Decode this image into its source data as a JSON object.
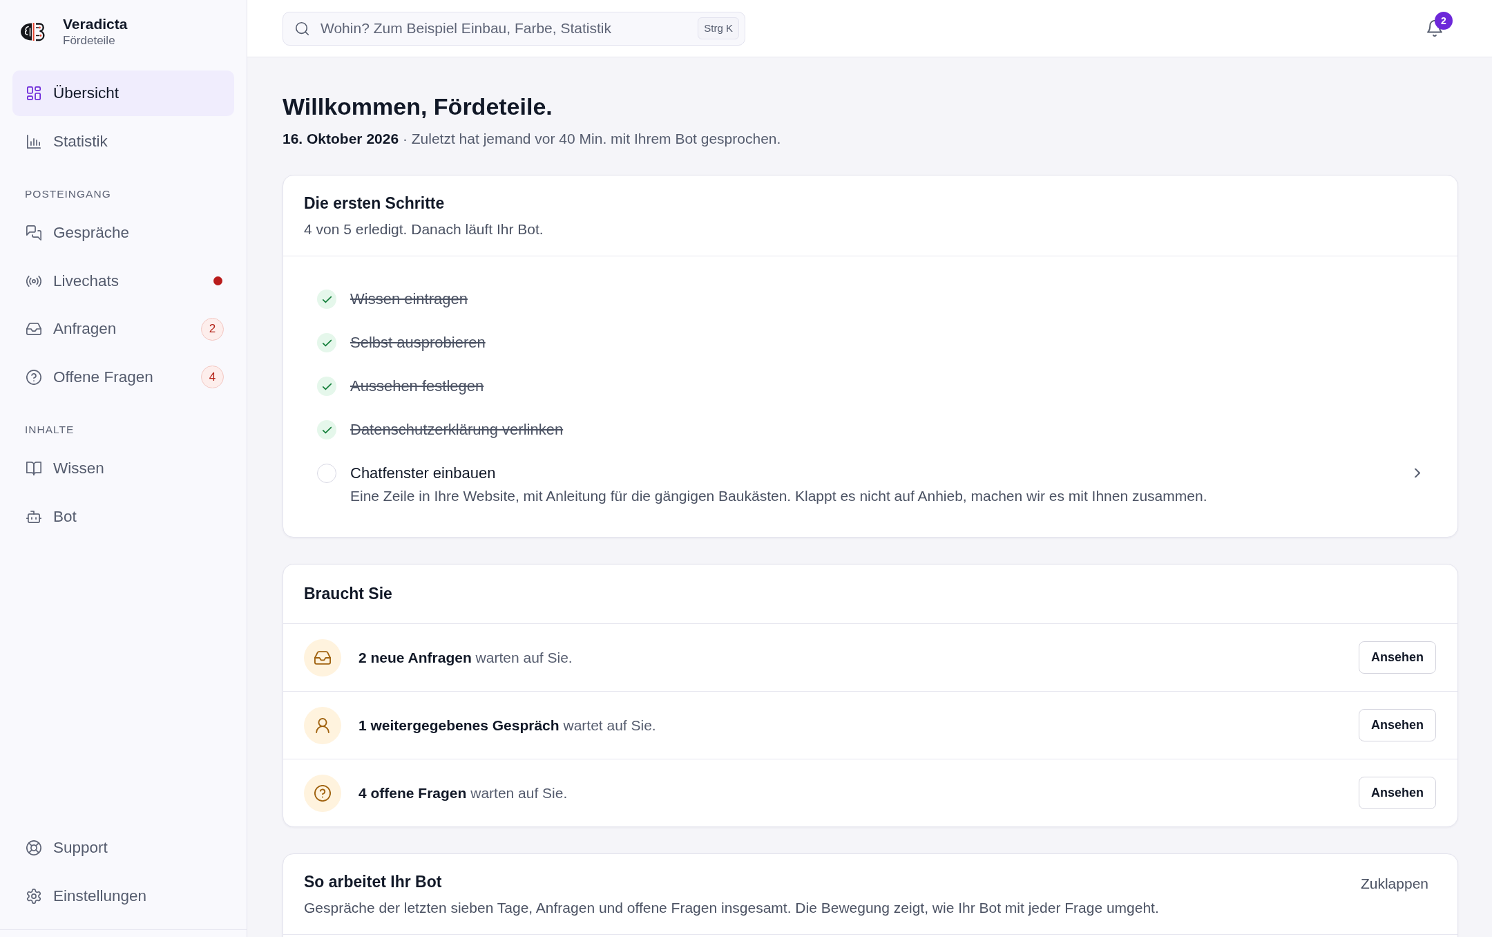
{
  "sidebar": {
    "brand": {
      "name": "Veradicta",
      "subtitle": "Fördeteile"
    },
    "sections": [
      {
        "items": [
          {
            "label": "Übersicht",
            "selected": true,
            "dot": false
          },
          {
            "label": "Statistik",
            "selected": false,
            "dot": false
          }
        ]
      },
      {
        "heading": "POSTEINGANG",
        "items": [
          {
            "label": "Gespräche",
            "selected": false,
            "dot": false
          },
          {
            "label": "Livechats",
            "selected": false,
            "dot": true
          },
          {
            "label": "Anfragen",
            "selected": false,
            "dot": false,
            "badge": "2"
          },
          {
            "label": "Offene Fragen",
            "selected": false,
            "dot": false,
            "badge": "4"
          }
        ]
      },
      {
        "heading": "INHALTE",
        "items": [
          {
            "label": "Wissen",
            "selected": false,
            "dot": false
          },
          {
            "label": "Bot",
            "selected": false,
            "dot": false
          }
        ]
      }
    ],
    "footer_items": [
      {
        "label": "Support",
        "selected": false
      },
      {
        "label": "Einstellungen",
        "selected": false
      }
    ]
  },
  "topbar": {
    "search": {
      "placeholder": "Wohin? Zum Beispiel Einbau, Farbe, Statistik",
      "shortcut": "Strg K"
    },
    "notifications": {
      "count": "2"
    }
  },
  "page": {
    "title": "Willkommen, Fördeteile.",
    "subtitle": "**16. Oktober 2026** · Zuletzt hat jemand vor 40 Min. mit Ihrem Bot gesprochen."
  },
  "onboarding": {
    "title": "Die ersten Schritte",
    "subtitle": "4 von 5 erledigt. Danach läuft Ihr Bot.",
    "steps": [
      {
        "label": "Wissen eintragen",
        "checked": true
      },
      {
        "label": "Selbst ausprobieren",
        "checked": true
      },
      {
        "label": "Aussehen festlegen",
        "checked": true
      },
      {
        "label": "Datenschutzerklärung verlinken",
        "checked": true
      },
      {
        "label": "Chatfenster einbauen",
        "checked": false,
        "description": "Eine Zeile in Ihre Website, mit Anleitung für die gängigen Baukästen. Klappt es nicht auf Anhieb, machen wir es mit Ihnen zusammen."
      }
    ]
  },
  "attention": {
    "title": "Braucht Sie",
    "items": [
      {
        "text": "**2 neue Anfragen** warten auf Sie.",
        "action": "Ansehen"
      },
      {
        "text": "**1 weitergegebenes Gespräch** wartet auf Sie.",
        "action": "Ansehen"
      },
      {
        "text": "**4 offene Fragen** warten auf Sie.",
        "action": "Ansehen"
      }
    ]
  },
  "performance": {
    "title": "So arbeitet Ihr Bot",
    "description": "Gespräche der letzten sieben Tage, Anfragen und offene Fragen insgesamt. Die Bewegung zeigt, wie Ihr Bot mit jeder Frage umgeht.",
    "toggle": "Zuklappen"
  }
}
